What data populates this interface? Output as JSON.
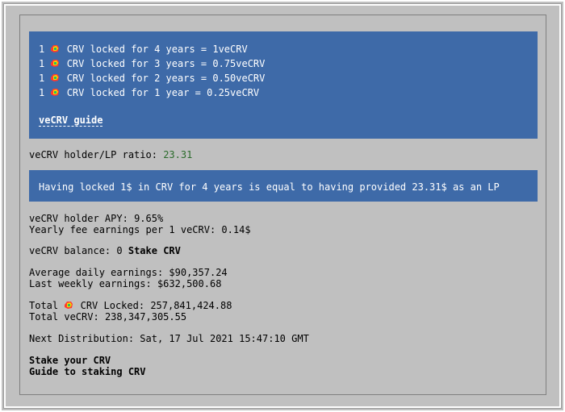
{
  "lock_table": {
    "rows": [
      {
        "prefix": "1",
        "token": "CRV",
        "text": "locked for 4 years = 1veCRV"
      },
      {
        "prefix": "1",
        "token": "CRV",
        "text": "locked for 3 years = 0.75veCRV"
      },
      {
        "prefix": "1",
        "token": "CRV",
        "text": "locked for 2 years = 0.50veCRV"
      },
      {
        "prefix": "1",
        "token": "CRV",
        "text": "locked for 1 year = 0.25veCRV"
      }
    ],
    "guide_link": "veCRV guide"
  },
  "ratio": {
    "label": "veCRV holder/LP ratio:",
    "value": "23.31"
  },
  "lp_equivalence": "Having locked 1$ in CRV for 4 years is equal to having provided 23.31$ as an LP",
  "apy": {
    "label": "veCRV holder APY:",
    "value": "9.65%"
  },
  "fee_earnings": {
    "label": "Yearly fee earnings per 1 veCRV:",
    "value": "0.14$"
  },
  "balance": {
    "label": "veCRV balance:",
    "value": "0",
    "stake_link": "Stake CRV"
  },
  "earnings": {
    "daily_label": "Average daily earnings:",
    "daily_value": "$90,357.24",
    "weekly_label": "Last weekly earnings:",
    "weekly_value": "$632,500.68"
  },
  "totals": {
    "crv_locked_prefix": "Total",
    "crv_locked_label": "CRV Locked:",
    "crv_locked_value": "257,841,424.88",
    "vecrv_label": "Total veCRV:",
    "vecrv_value": "238,347,305.55"
  },
  "distribution": {
    "label": "Next Distribution:",
    "value": "Sat, 17 Jul 2021 15:47:10 GMT"
  },
  "links": {
    "stake_your_crv": "Stake your CRV",
    "guide_to_staking": "Guide to staking CRV"
  },
  "colors": {
    "background": "#c0c0c0",
    "blue_box": "#3e6aa8",
    "ratio_value": "#2a6b2a"
  },
  "icons": {
    "crv": "crv-token-icon"
  }
}
